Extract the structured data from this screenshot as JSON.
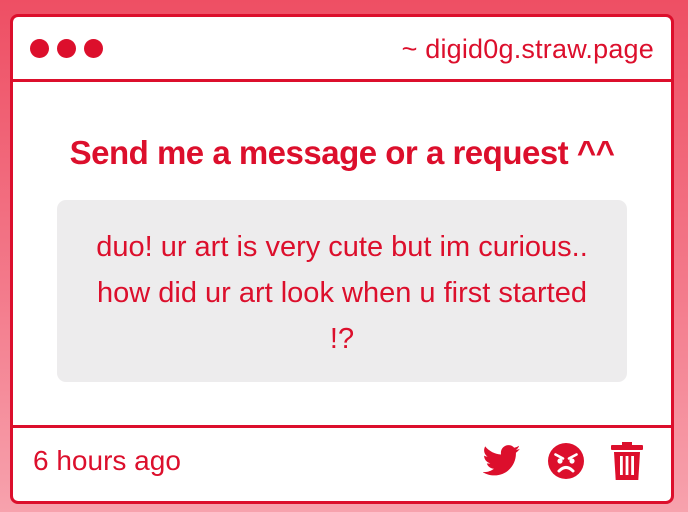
{
  "window": {
    "url": "~ digid0g.straw.page"
  },
  "main": {
    "heading": "Send me a message or a request ^^",
    "message": "duo! ur art is very cute but im curious.. how did ur art look when u first started !?"
  },
  "footer": {
    "timestamp": "6 hours ago",
    "icons": [
      "twitter-icon",
      "angry-face-icon",
      "trash-icon"
    ]
  },
  "colors": {
    "accent": "#dc0f2c",
    "message_bg": "#edeced",
    "page_bg_top": "#ee4f64",
    "page_bg_bottom": "#f7a2ad"
  }
}
